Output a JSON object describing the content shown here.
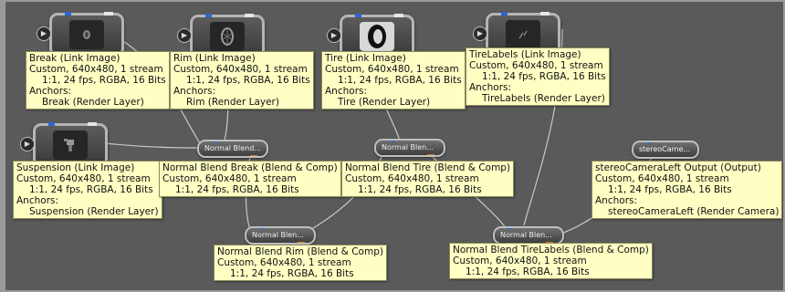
{
  "image_nodes": [
    {
      "id": "break",
      "thumb": "brake-thumbnail"
    },
    {
      "id": "rim",
      "thumb": "rim-thumbnail"
    },
    {
      "id": "tire",
      "thumb": "tire-thumbnail"
    },
    {
      "id": "tirelabels",
      "thumb": "tirelabels-thumbnail"
    },
    {
      "id": "suspension",
      "thumb": "suspension-thumbnail"
    }
  ],
  "pills": {
    "blend_break": "Normal Blend...",
    "blend_tire": "Normal Blen...",
    "blend_rim": "Normal Blen...",
    "blend_tirelabels": "Normal Blen...",
    "output": "stereoCame..."
  },
  "labels": {
    "break": {
      "title": "Break (Link Image)",
      "line1": "Custom, 640x480, 1 stream",
      "line2": "1:1, 24 fps, RGBA, 16 Bits",
      "anchors": "Anchors:",
      "anchor": "Break (Render Layer)"
    },
    "rim": {
      "title": "Rim (Link Image)",
      "line1": "Custom, 640x480, 1 stream",
      "line2": "1:1, 24 fps, RGBA, 16 Bits",
      "anchors": "Anchors:",
      "anchor": "Rim (Render Layer)"
    },
    "tire": {
      "title": "Tire (Link Image)",
      "line1": "Custom, 640x480, 1 stream",
      "line2": "1:1, 24 fps, RGBA, 16 Bits",
      "anchors": "Anchors:",
      "anchor": "Tire (Render Layer)"
    },
    "tirelabels": {
      "title": "TireLabels (Link Image)",
      "line1": "Custom, 640x480, 1 stream",
      "line2": "1:1, 24 fps, RGBA, 16 Bits",
      "anchors": "Anchors:",
      "anchor": "TireLabels (Render Layer)"
    },
    "suspension": {
      "title": "Suspension (Link Image)",
      "line1": "Custom, 640x480, 1 stream",
      "line2": "1:1, 24 fps, RGBA, 16 Bits",
      "anchors": "Anchors:",
      "anchor": "Suspension (Render Layer)"
    },
    "blend_break": {
      "title": "Normal Blend Break (Blend & Comp)",
      "line1": "Custom, 640x480, 1 stream",
      "line2": "1:1, 24 fps, RGBA, 16 Bits"
    },
    "blend_tire": {
      "title": "Normal Blend Tire (Blend & Comp)",
      "line1": "Custom, 640x480, 1 stream",
      "line2": "1:1, 24 fps, RGBA, 16 Bits"
    },
    "blend_rim": {
      "title": "Normal Blend Rim (Blend & Comp)",
      "line1": "Custom, 640x480, 1 stream",
      "line2": "1:1, 24 fps, RGBA, 16 Bits"
    },
    "blend_tirelabels": {
      "title": "Normal Blend TireLabels (Blend & Comp)",
      "line1": "Custom, 640x480, 1 stream",
      "line2": "1:1, 24 fps, RGBA, 16 Bits"
    },
    "output": {
      "title": "stereoCameraLeft Output (Output)",
      "line1": "Custom, 640x480, 1 stream",
      "line2": "1:1, 24 fps, RGBA, 16 Bits",
      "anchors": "Anchors:",
      "anchor": "stereoCameraLeft (Render Camera)"
    }
  },
  "colors": {
    "canvas": "#5a5a5a",
    "label_bg": "#ffffc4",
    "port_blue": "#2a66d6",
    "port_orange": "#e07a20"
  }
}
